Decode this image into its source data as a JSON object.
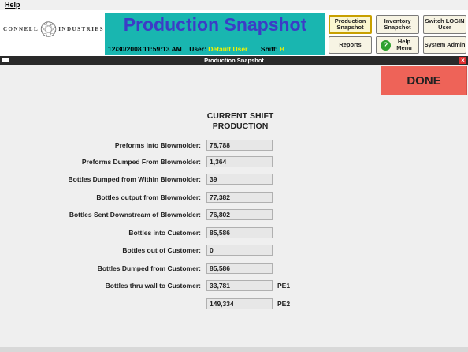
{
  "menu": {
    "help_label": "Help"
  },
  "logo": {
    "left_text": "CONNELL",
    "right_text": "INDUSTRIES"
  },
  "banner": {
    "title": "Production Snapshot",
    "datetime": "12/30/2008 11:59:13 AM",
    "user_label": "User:",
    "user_value": "Default User",
    "shift_label": "Shift:",
    "shift_value": "B"
  },
  "nav_buttons": {
    "production_snapshot": "Production Snapshot",
    "inventory_snapshot": "Inventory Snapshot",
    "switch_login_user": "Switch LOGIN User",
    "reports": "Reports",
    "help_menu": "Help Menu",
    "system_admin": "System Admin"
  },
  "window": {
    "title": "Production Snapshot",
    "close_glyph": "×"
  },
  "done_button": "DONE",
  "section_title_line1": "CURRENT SHIFT",
  "section_title_line2": "PRODUCTION",
  "rows": [
    {
      "label": "Preforms into Blowmolder:",
      "value": "78,788"
    },
    {
      "label": "Preforms Dumped From Blowmolder:",
      "value": "1,364"
    },
    {
      "label": "Bottles Dumped from Within Blowmolder:",
      "value": "39"
    },
    {
      "label": "Bottles output from Blowmolder:",
      "value": "77,382"
    },
    {
      "label": "Bottles Sent Downstream of Blowmolder:",
      "value": "76,802"
    },
    {
      "label": "Bottles into Customer:",
      "value": "85,586"
    },
    {
      "label": "Bottles out of Customer:",
      "value": "0"
    },
    {
      "label": "Bottles Dumped from Customer:",
      "value": "85,586"
    },
    {
      "label": "Bottles thru wall to Customer:",
      "value": "33,781",
      "suffix": "PE1"
    },
    {
      "label": "",
      "value": "149,334",
      "suffix": "PE2"
    }
  ],
  "colors": {
    "banner_bg": "#19b6b0",
    "title_text": "#3c3cc6",
    "user_text": "#f2f200",
    "done_bg": "#ee6358",
    "titlebar_bg": "#2a2a2a"
  },
  "icons": {
    "logo_mark": "globe-ribbon-icon",
    "help_icon": "question-circle-icon",
    "close_icon": "close-x-icon",
    "window_box_icon": "window-menu-icon"
  }
}
